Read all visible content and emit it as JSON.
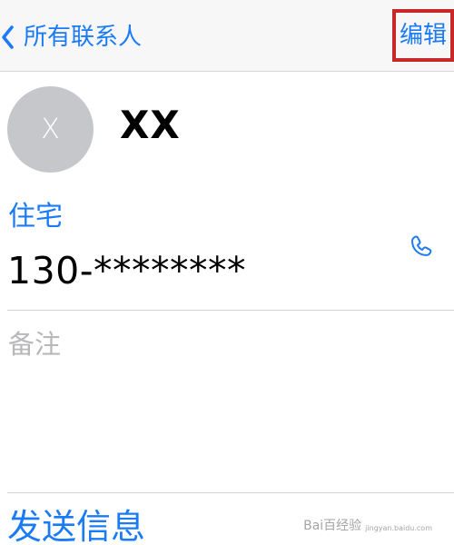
{
  "header": {
    "back_label": "所有联系人",
    "edit_label": "编辑"
  },
  "contact": {
    "avatar_initial": "X",
    "name": "XX"
  },
  "phone": {
    "type": "住宅",
    "number": "130-********"
  },
  "notes": {
    "label": "备注"
  },
  "actions": {
    "send_message": "发送信息"
  },
  "watermark": {
    "logo": "Bai百经验",
    "subtitle": "jingyan.baidu.com"
  },
  "colors": {
    "accent": "#1b7bf5",
    "highlight": "#c82828",
    "avatar": "#c6c7cb",
    "divider": "#d5d5d8",
    "placeholder": "#b8b8bb"
  },
  "icons": {
    "back": "chevron-left-icon",
    "call": "phone-icon"
  }
}
